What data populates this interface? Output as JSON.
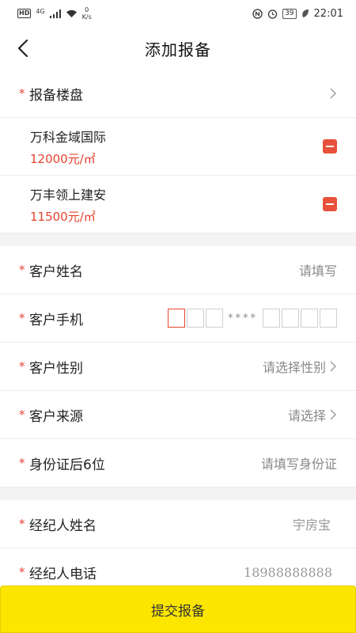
{
  "status_bar": {
    "hd": "HD",
    "network": "4G",
    "speed_value": "0",
    "speed_unit": "K/s",
    "battery": "39",
    "time": "22:01"
  },
  "header": {
    "title": "添加报备"
  },
  "property": {
    "label": "报备楼盘",
    "items": [
      {
        "name": "万科金域国际",
        "price": "12000元/㎡"
      },
      {
        "name": "万丰领上建安",
        "price": "11500元/㎡"
      }
    ]
  },
  "customer": {
    "name_label": "客户姓名",
    "name_placeholder": "请填写",
    "phone_label": "客户手机",
    "phone_mask": "****",
    "gender_label": "客户性别",
    "gender_placeholder": "请选择性别",
    "source_label": "客户来源",
    "source_placeholder": "请选择",
    "id_label": "身份证后6位",
    "id_placeholder": "请填写身份证"
  },
  "agent": {
    "name_label": "经纪人姓名",
    "name_value": "宇房宝",
    "phone_label": "经纪人电话",
    "phone_value": "18988888888"
  },
  "submit_label": "提交报备",
  "colors": {
    "accent_red": "#e5432f",
    "submit_yellow": "#fce600"
  },
  "icons": [
    "back-arrow-icon",
    "chevron-right-icon",
    "remove-icon",
    "wifi-icon",
    "signal-icon",
    "alarm-icon",
    "nfc-icon",
    "leaf-icon"
  ]
}
